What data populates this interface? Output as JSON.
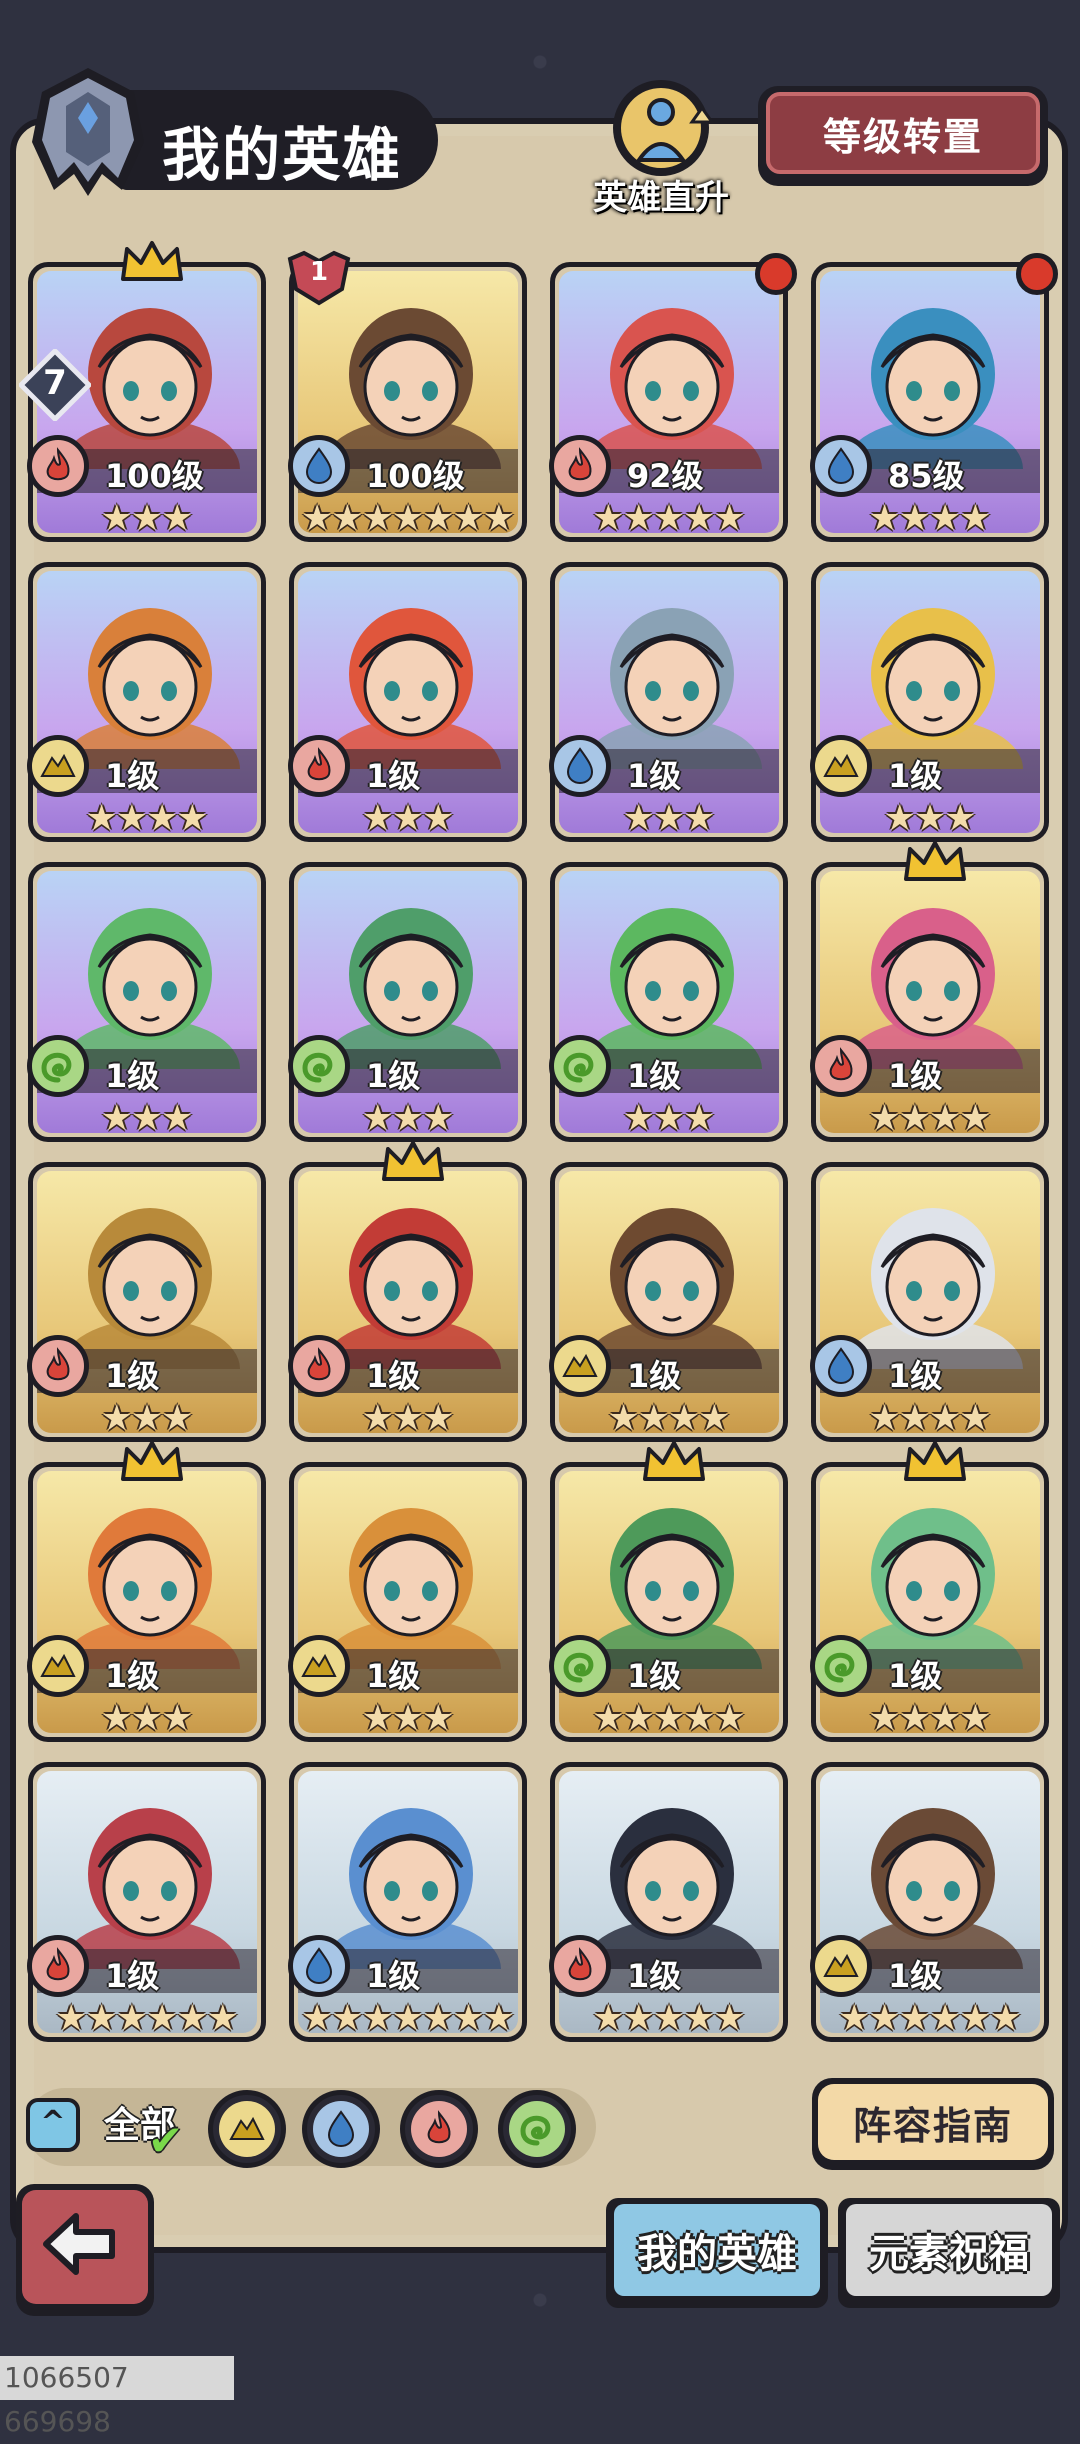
{
  "header": {
    "title": "我的英雄",
    "promote_label": "英雄直升",
    "level_transfer_label": "等级转置"
  },
  "heroes": [
    {
      "level": "100级",
      "element": "fire",
      "rarity": "purple",
      "stars": 3,
      "crown": true,
      "rank_badge": "7",
      "upgrade_badge": "",
      "red_dot": false,
      "palette": "#b8483e"
    },
    {
      "level": "100级",
      "element": "water",
      "rarity": "gold",
      "stars": 7,
      "crown": false,
      "rank_badge": "",
      "upgrade_badge": "1",
      "red_dot": false,
      "palette": "#6b4a33"
    },
    {
      "level": "92级",
      "element": "fire",
      "rarity": "purple",
      "stars": 5,
      "crown": false,
      "rank_badge": "",
      "upgrade_badge": "",
      "red_dot": true,
      "palette": "#d9544f"
    },
    {
      "level": "85级",
      "element": "water",
      "rarity": "purple",
      "stars": 4,
      "crown": false,
      "rank_badge": "",
      "upgrade_badge": "",
      "red_dot": true,
      "palette": "#3a8fbf"
    },
    {
      "level": "1级",
      "element": "earth",
      "rarity": "purple",
      "stars": 4,
      "crown": false,
      "rank_badge": "",
      "upgrade_badge": "",
      "red_dot": false,
      "palette": "#d9803a"
    },
    {
      "level": "1级",
      "element": "fire",
      "rarity": "purple",
      "stars": 3,
      "crown": false,
      "rank_badge": "",
      "upgrade_badge": "",
      "red_dot": false,
      "palette": "#e0563c"
    },
    {
      "level": "1级",
      "element": "water",
      "rarity": "purple",
      "stars": 3,
      "crown": false,
      "rank_badge": "",
      "upgrade_badge": "",
      "red_dot": false,
      "palette": "#8aa2b5"
    },
    {
      "level": "1级",
      "element": "earth",
      "rarity": "purple",
      "stars": 3,
      "crown": false,
      "rank_badge": "",
      "upgrade_badge": "",
      "red_dot": false,
      "palette": "#e8c04a"
    },
    {
      "level": "1级",
      "element": "wind",
      "rarity": "purple",
      "stars": 3,
      "crown": false,
      "rank_badge": "",
      "upgrade_badge": "",
      "red_dot": false,
      "palette": "#5fb86a"
    },
    {
      "level": "1级",
      "element": "wind",
      "rarity": "purple",
      "stars": 3,
      "crown": false,
      "rank_badge": "",
      "upgrade_badge": "",
      "red_dot": false,
      "palette": "#4f9e6a"
    },
    {
      "level": "1级",
      "element": "wind",
      "rarity": "purple",
      "stars": 3,
      "crown": false,
      "rank_badge": "",
      "upgrade_badge": "",
      "red_dot": false,
      "palette": "#5cb860"
    },
    {
      "level": "1级",
      "element": "fire",
      "rarity": "gold",
      "stars": 4,
      "crown": true,
      "rank_badge": "",
      "upgrade_badge": "",
      "red_dot": false,
      "palette": "#d9608a"
    },
    {
      "level": "1级",
      "element": "fire",
      "rarity": "gold",
      "stars": 3,
      "crown": false,
      "rank_badge": "",
      "upgrade_badge": "",
      "red_dot": false,
      "palette": "#b88a3a"
    },
    {
      "level": "1级",
      "element": "fire",
      "rarity": "gold",
      "stars": 3,
      "crown": true,
      "rank_badge": "",
      "upgrade_badge": "",
      "red_dot": false,
      "palette": "#c23c36"
    },
    {
      "level": "1级",
      "element": "earth",
      "rarity": "gold",
      "stars": 4,
      "crown": false,
      "rank_badge": "",
      "upgrade_badge": "",
      "red_dot": false,
      "palette": "#6e4a30"
    },
    {
      "level": "1级",
      "element": "water",
      "rarity": "gold",
      "stars": 4,
      "crown": false,
      "rank_badge": "",
      "upgrade_badge": "",
      "red_dot": false,
      "palette": "#dfe3ea"
    },
    {
      "level": "1级",
      "element": "earth",
      "rarity": "gold",
      "stars": 3,
      "crown": true,
      "rank_badge": "",
      "upgrade_badge": "",
      "red_dot": false,
      "palette": "#e07a3a"
    },
    {
      "level": "1级",
      "element": "earth",
      "rarity": "gold",
      "stars": 3,
      "crown": false,
      "rank_badge": "",
      "upgrade_badge": "",
      "red_dot": false,
      "palette": "#d9903a"
    },
    {
      "level": "1级",
      "element": "wind",
      "rarity": "gold",
      "stars": 5,
      "crown": true,
      "rank_badge": "",
      "upgrade_badge": "",
      "red_dot": false,
      "palette": "#4e9a5a"
    },
    {
      "level": "1级",
      "element": "wind",
      "rarity": "gold",
      "stars": 4,
      "crown": true,
      "rank_badge": "",
      "upgrade_badge": "",
      "red_dot": false,
      "palette": "#6fbf8a"
    },
    {
      "level": "1级",
      "element": "fire",
      "rarity": "blue",
      "stars": 6,
      "crown": false,
      "rank_badge": "",
      "upgrade_badge": "",
      "red_dot": false,
      "palette": "#b8404a"
    },
    {
      "level": "1级",
      "element": "water",
      "rarity": "blue",
      "stars": 7,
      "crown": false,
      "rank_badge": "",
      "upgrade_badge": "",
      "red_dot": false,
      "palette": "#5a8fd0"
    },
    {
      "level": "1级",
      "element": "fire",
      "rarity": "blue",
      "stars": 5,
      "crown": false,
      "rank_badge": "",
      "upgrade_badge": "",
      "red_dot": false,
      "palette": "#2a2f3e"
    },
    {
      "level": "1级",
      "element": "earth",
      "rarity": "blue",
      "stars": 6,
      "crown": false,
      "rank_badge": "",
      "upgrade_badge": "",
      "red_dot": false,
      "palette": "#6a4a36"
    }
  ],
  "filter": {
    "expand_icon": "chevron-up-icon",
    "all_label": "全部",
    "elements": [
      "earth",
      "water",
      "fire",
      "wind"
    ]
  },
  "lineup_guide_label": "阵容指南",
  "tabs": {
    "my_heroes": "我的英雄",
    "element_blessing": "元素祝福"
  },
  "device_id": "1066507 669698",
  "colors": {
    "fire": "#e9a7a0",
    "water": "#a8c6e6",
    "earth": "#ecd98d",
    "wind": "#a9d785",
    "star": "#f3dcab",
    "panel": "#d9cdb1"
  }
}
